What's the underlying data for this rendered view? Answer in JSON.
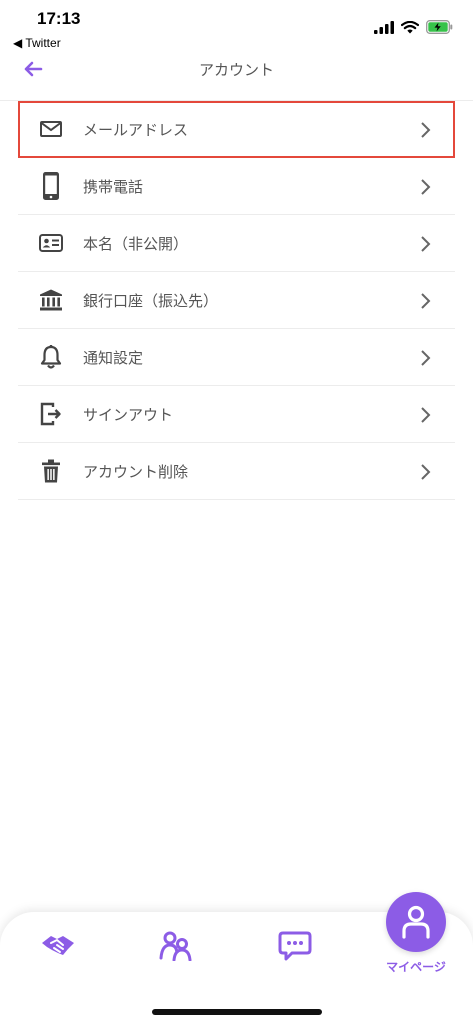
{
  "status": {
    "time": "17:13",
    "back_app": "◀ Twitter"
  },
  "nav": {
    "title": "アカウント",
    "accent": "#8c5ce6"
  },
  "menu": {
    "items": [
      {
        "label": "メールアドレス",
        "icon": "mail-icon",
        "highlighted": true
      },
      {
        "label": "携帯電話",
        "icon": "phone-icon"
      },
      {
        "label": "本名（非公開）",
        "icon": "id-card-icon"
      },
      {
        "label": "銀行口座（振込先）",
        "icon": "bank-icon"
      },
      {
        "label": "通知設定",
        "icon": "bell-icon"
      },
      {
        "label": "サインアウト",
        "icon": "sign-out-icon"
      },
      {
        "label": "アカウント削除",
        "icon": "trash-icon"
      }
    ]
  },
  "tabbar": {
    "tabs": [
      {
        "icon": "handshake-icon"
      },
      {
        "icon": "people-icon"
      },
      {
        "icon": "chat-icon"
      },
      {
        "icon": "person-icon",
        "label": "マイページ",
        "active": true
      }
    ]
  },
  "colors": {
    "highlight_border": "#e4483b",
    "icon": "#444444",
    "accent": "#8c5ce6"
  }
}
